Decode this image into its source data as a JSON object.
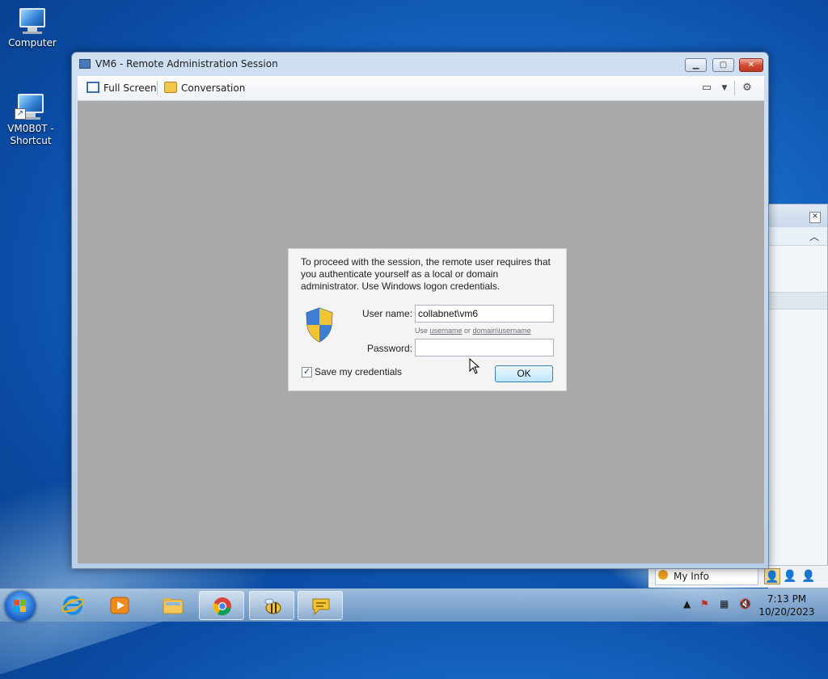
{
  "desktop": {
    "icons": [
      {
        "label": "Computer"
      },
      {
        "label": "VM0B0T - Shortcut"
      }
    ]
  },
  "window": {
    "title": "VM6 - Remote Administration Session",
    "controls": {
      "minimize": "▁",
      "maximize": "▢",
      "close": "✕"
    },
    "toolbar": {
      "full_screen": "Full Screen",
      "conversation": "Conversation"
    }
  },
  "dialog": {
    "message": "To proceed with the session, the remote user requires that you authenticate yourself as a local or domain administrator. Use Windows logon credentials.",
    "username_label": "User name:",
    "username_value": "collabnet\\vm6",
    "hint_prefix": "Use ",
    "hint_username": "username",
    "hint_or": " or ",
    "hint_domain_username": "domain\\username",
    "password_label": "Password:",
    "password_value": "",
    "save_credentials_label": "Save my credentials",
    "save_credentials_checked": true,
    "ok_label": "OK"
  },
  "side_panel": {
    "my_info": "My Info"
  },
  "taskbar": {
    "apps": [
      "start",
      "internet-explorer",
      "media-player",
      "file-explorer",
      "chrome",
      "bee-app",
      "chat-app"
    ],
    "clock_time": "7:13 PM",
    "clock_date": "10/20/2023"
  },
  "colors": {
    "desktop": "#1a6fcf",
    "remote_area": "#a9a9a9",
    "ok_border": "#3c7fb1"
  }
}
